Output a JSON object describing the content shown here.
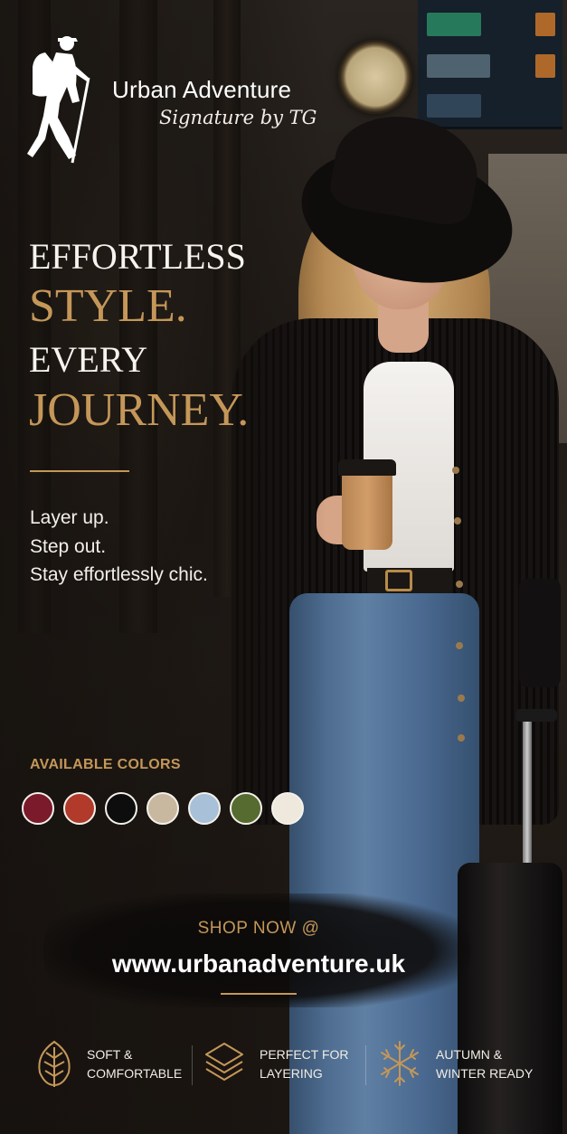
{
  "brand": {
    "name": "Urban Adventure",
    "signature": "Signature by TG",
    "logo_icon": "hiker-icon"
  },
  "headline": {
    "line1": "EFFORTLESS",
    "line2": "STYLE.",
    "line3": "EVERY",
    "line4": "JOURNEY."
  },
  "tagline": {
    "line1": "Layer up.",
    "line2": "Step out.",
    "line3": "Stay effortlessly chic."
  },
  "colors": {
    "label": "AVAILABLE COLORS",
    "swatches": [
      {
        "name": "burgundy",
        "hex": "#7a1a2a"
      },
      {
        "name": "rust",
        "hex": "#b13a2a"
      },
      {
        "name": "black",
        "hex": "#0d0d0d"
      },
      {
        "name": "beige",
        "hex": "#c9b8a0"
      },
      {
        "name": "light-blue",
        "hex": "#a8c0d8"
      },
      {
        "name": "olive",
        "hex": "#556b2f"
      },
      {
        "name": "cream",
        "hex": "#efe9dd"
      }
    ]
  },
  "shop": {
    "label": "SHOP NOW @",
    "url": "www.urbanadventure.uk"
  },
  "features": [
    {
      "icon": "leaf-icon",
      "line1": "SOFT &",
      "line2": "COMFORTABLE"
    },
    {
      "icon": "layers-icon",
      "line1": "PERFECT FOR",
      "line2": "LAYERING"
    },
    {
      "icon": "snowflake-icon",
      "line1": "AUTUMN &",
      "line2": "WINTER READY"
    }
  ],
  "accent_color": "#c49759"
}
